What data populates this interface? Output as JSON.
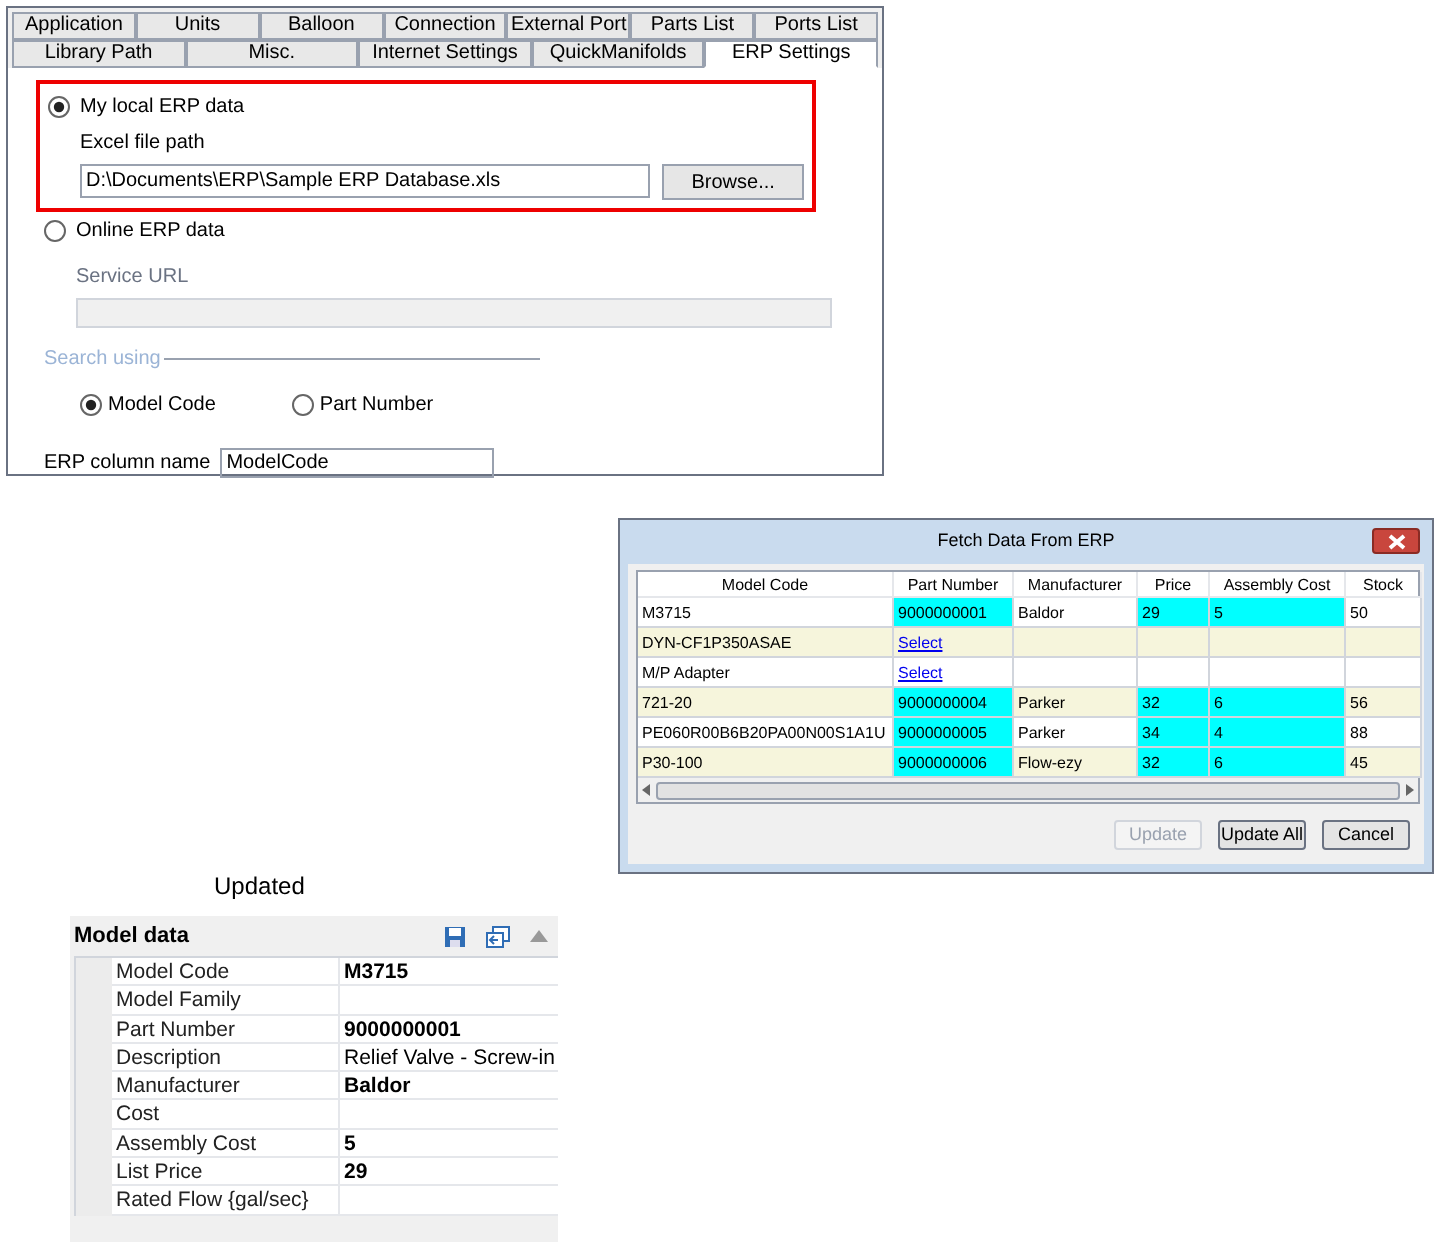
{
  "settings": {
    "tab_rows": [
      [
        {
          "label": "Application",
          "selected": false
        },
        {
          "label": "Units",
          "selected": false
        },
        {
          "label": "Balloon",
          "selected": false
        },
        {
          "label": "Connection",
          "selected": false
        },
        {
          "label": "External Port",
          "selected": false
        },
        {
          "label": "Parts List",
          "selected": false
        },
        {
          "label": "Ports List",
          "selected": false
        }
      ],
      [
        {
          "label": "Library Path",
          "selected": false
        },
        {
          "label": "Misc.",
          "selected": false
        },
        {
          "label": "Internet Settings",
          "selected": false
        },
        {
          "label": "QuickManifolds",
          "selected": false
        },
        {
          "label": "ERP Settings",
          "selected": true
        }
      ]
    ],
    "local": {
      "label": "My local ERP data",
      "selected": true,
      "field_label": "Excel file path",
      "value": "D:\\Documents\\ERP\\Sample ERP Database.xls",
      "button": "Browse..."
    },
    "online": {
      "label": "Online ERP data",
      "selected": false,
      "field_label": "Service URL",
      "disabled": true
    },
    "search_using": {
      "label": "Search using",
      "options": [
        {
          "label": "Model Code",
          "selected": true
        },
        {
          "label": "Part Number",
          "selected": false
        }
      ]
    },
    "column_name": {
      "label": "ERP column name",
      "value": "ModelCode"
    }
  },
  "dialog": {
    "title": "Fetch Data From ERP",
    "columns": [
      "Model Code",
      "Part Number",
      "Manufacturer",
      "Price",
      "Assembly Cost",
      "Stock"
    ],
    "rows": [
      {
        "cells": [
          {
            "text": "M3715",
            "highlighted": false
          },
          {
            "text": "9000000001",
            "highlighted": true
          },
          {
            "text": "Baldor",
            "highlighted": false
          },
          {
            "text": "29",
            "highlighted": true
          },
          {
            "text": "5",
            "highlighted": true
          },
          {
            "text": "50",
            "highlighted": false
          }
        ]
      },
      {
        "cells": [
          {
            "text": "DYN-CF1P350ASAE",
            "highlighted": false
          },
          {
            "text": "Select",
            "kind": "link",
            "highlighted": false
          },
          {
            "highlighted": false
          },
          {
            "highlighted": false
          },
          {
            "highlighted": false
          },
          {
            "highlighted": false
          }
        ]
      },
      {
        "cells": [
          {
            "text": "M/P Adapter",
            "highlighted": false
          },
          {
            "text": "Select",
            "kind": "link",
            "highlighted": false
          },
          {
            "highlighted": false
          },
          {
            "highlighted": false
          },
          {
            "highlighted": false
          },
          {
            "highlighted": false
          }
        ]
      },
      {
        "cells": [
          {
            "text": "721-20",
            "highlighted": false
          },
          {
            "text": "9000000004",
            "highlighted": true
          },
          {
            "text": "Parker",
            "highlighted": false
          },
          {
            "text": "32",
            "highlighted": true
          },
          {
            "text": "6",
            "highlighted": true
          },
          {
            "text": "56",
            "highlighted": false
          }
        ]
      },
      {
        "cells": [
          {
            "text": "PE060R00B6B20PA00N00S1A1U",
            "highlighted": false
          },
          {
            "text": "9000000005",
            "highlighted": true
          },
          {
            "text": "Parker",
            "highlighted": false
          },
          {
            "text": "34",
            "highlighted": true
          },
          {
            "text": "4",
            "highlighted": true
          },
          {
            "text": "88",
            "highlighted": false
          }
        ]
      },
      {
        "cells": [
          {
            "text": "P30-100",
            "highlighted": false
          },
          {
            "text": "9000000006",
            "highlighted": true
          },
          {
            "text": "Flow-ezy",
            "highlighted": false
          },
          {
            "text": "32",
            "highlighted": true
          },
          {
            "text": "6",
            "highlighted": true
          },
          {
            "text": "45",
            "highlighted": false
          }
        ]
      }
    ],
    "buttons": [
      {
        "label": "Update",
        "disabled": true
      },
      {
        "label": "Update All",
        "disabled": false
      },
      {
        "label": "Cancel",
        "disabled": false
      }
    ]
  },
  "caption": "Updated",
  "model_data": {
    "title": "Model data",
    "rows": [
      {
        "name": "Model Code",
        "value": "M3715",
        "updated": true
      },
      {
        "name": "Model Family"
      },
      {
        "name": "Part Number",
        "value": "9000000001",
        "updated": true
      },
      {
        "name": "Description",
        "value": "Relief Valve - Screw-in",
        "updated": false
      },
      {
        "name": "Manufacturer",
        "value": "Baldor",
        "updated": true
      },
      {
        "name": "Cost"
      },
      {
        "name": "Assembly Cost",
        "value": "5",
        "updated": true
      },
      {
        "name": "List Price",
        "value": "29",
        "updated": true
      },
      {
        "name": "Rated Flow {gal/sec}"
      }
    ]
  }
}
